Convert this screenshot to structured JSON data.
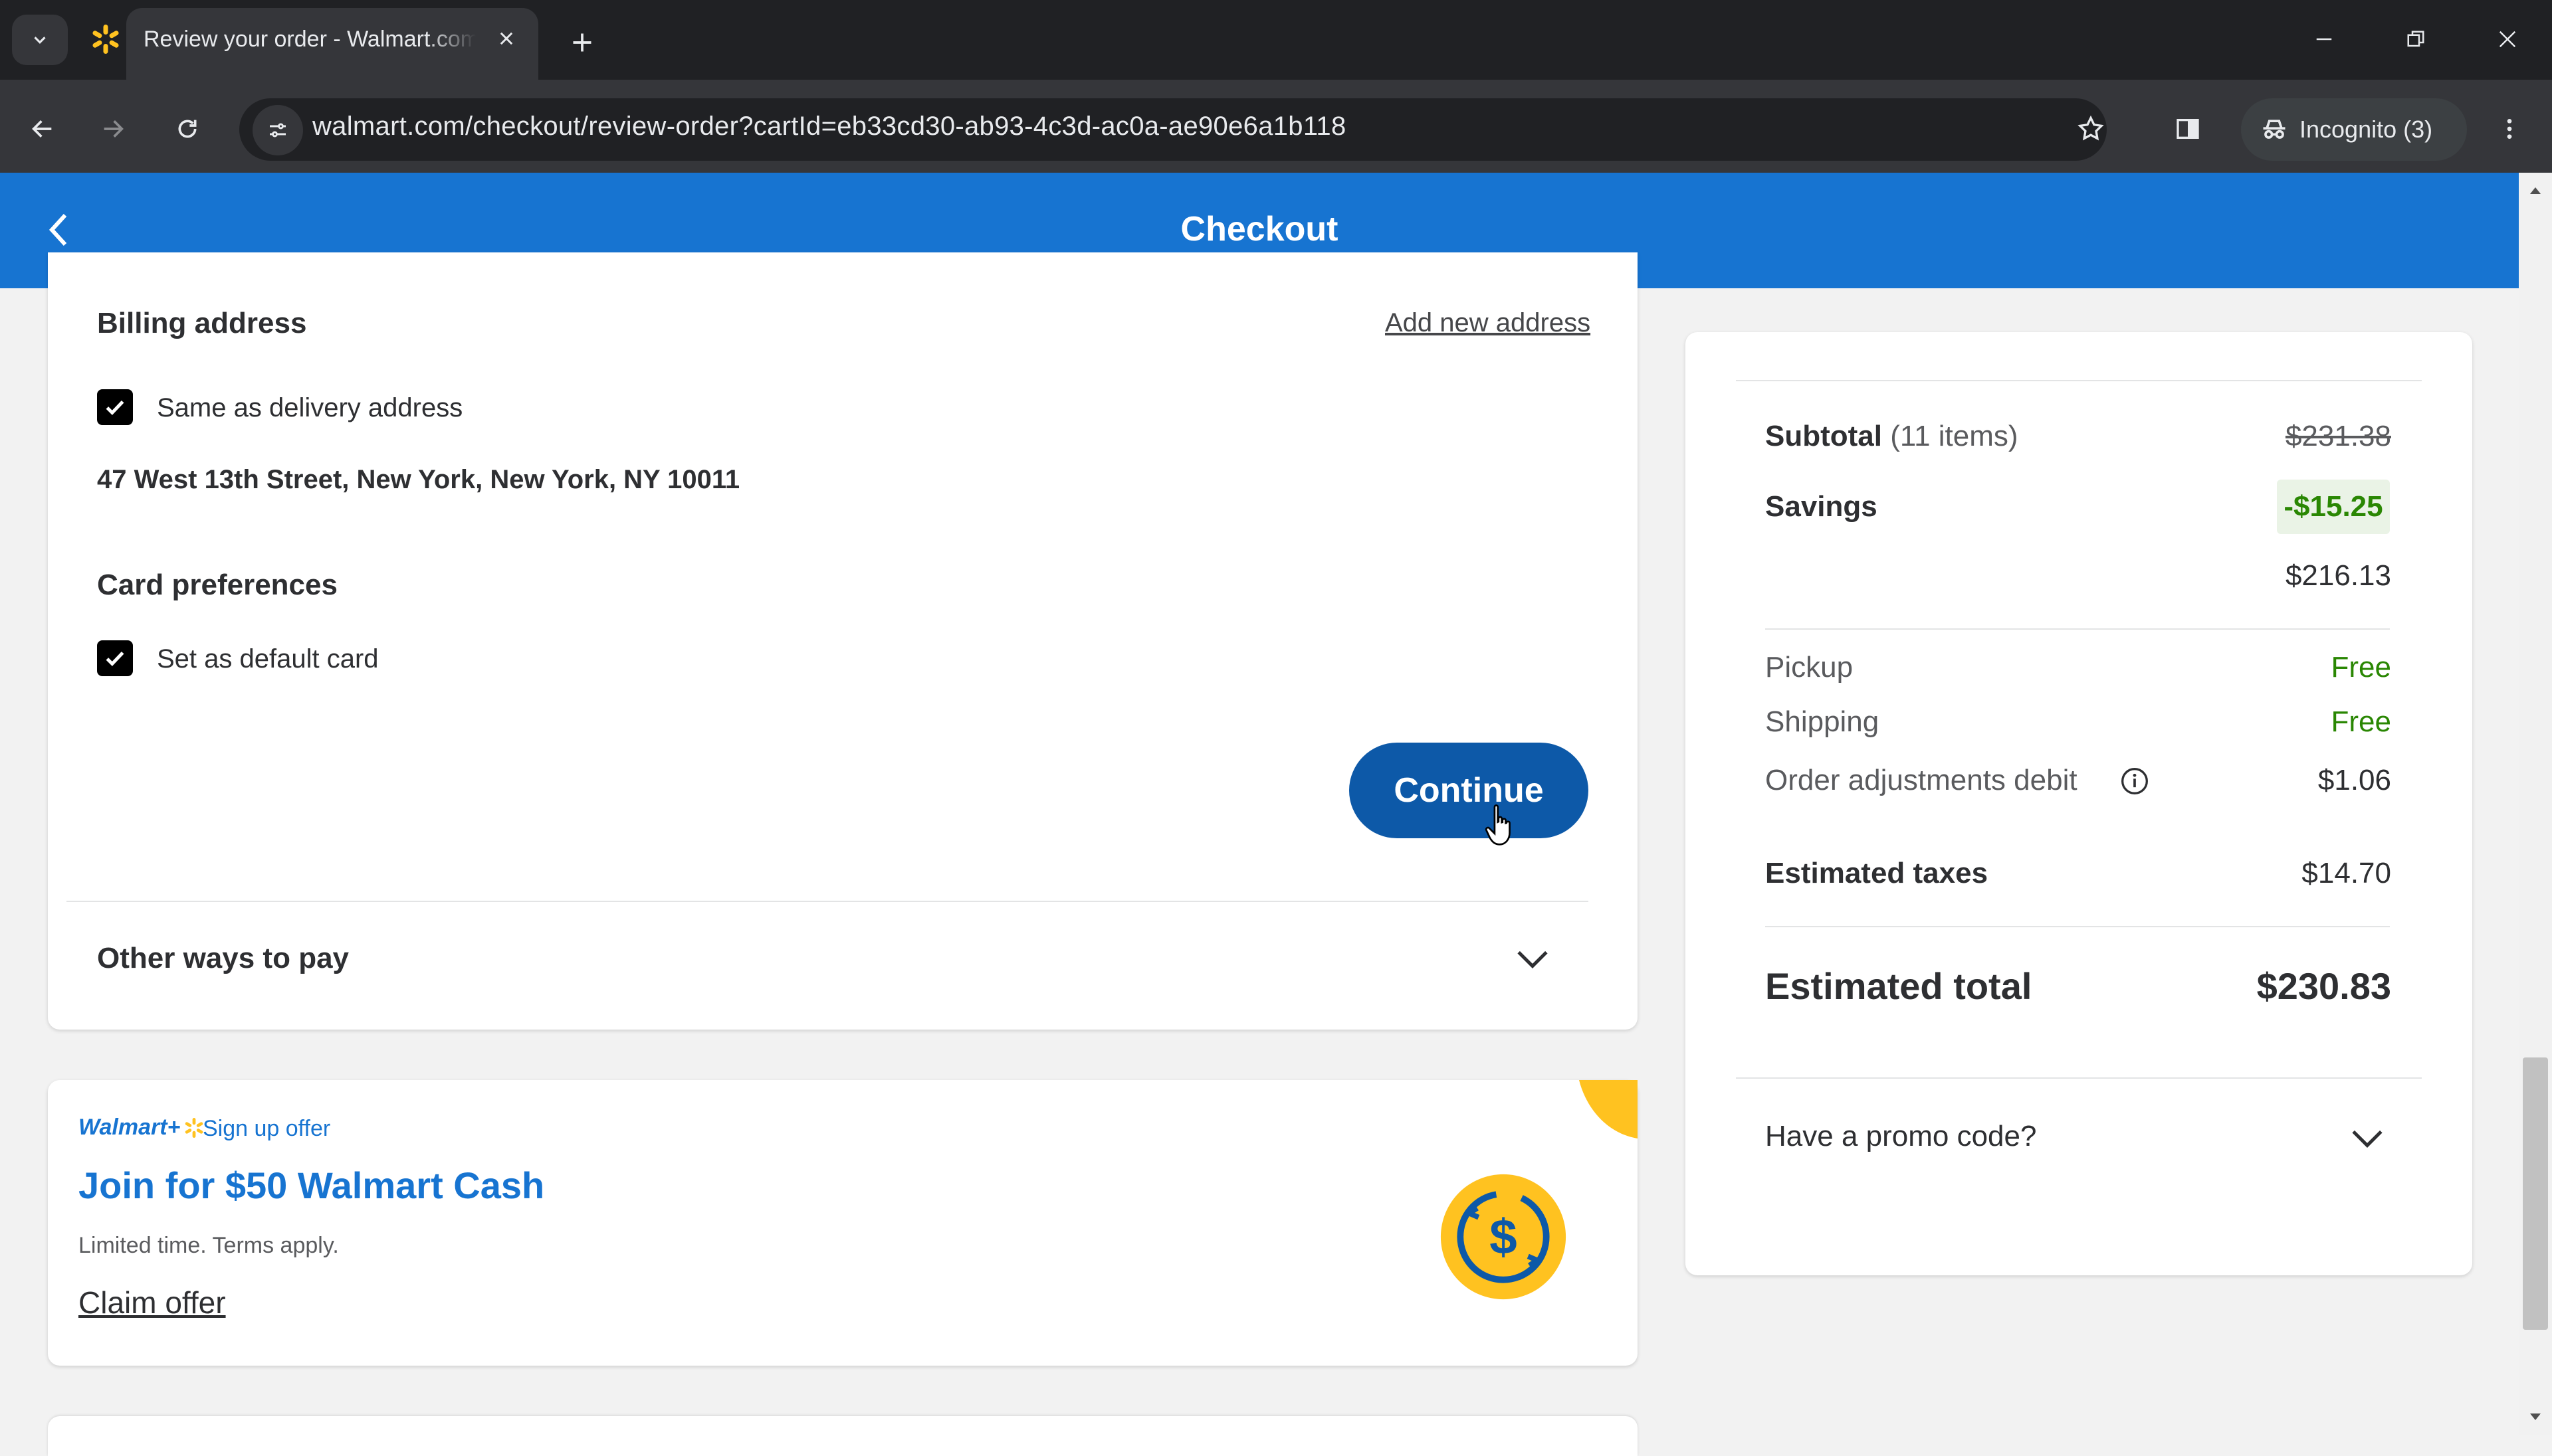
{
  "browser": {
    "tab_title": "Review your order - Walmart.com",
    "url": "walmart.com/checkout/review-order?cartId=eb33cd30-ab93-4c3d-ac0a-ae90e6a1b118",
    "incognito_label": "Incognito (3)"
  },
  "header": {
    "title": "Checkout"
  },
  "billing": {
    "title": "Billing address",
    "add_new_address": "Add new address",
    "same_as_delivery": "Same as delivery address",
    "address": "47 West 13th Street, New York, New York, NY 10011"
  },
  "card_preferences": {
    "title": "Card preferences",
    "set_default": "Set as default card"
  },
  "continue_label": "Continue",
  "other_ways_to_pay": "Other ways to pay",
  "walmart_plus": {
    "logo_text": "Walmart+",
    "offer_label": "Sign up offer",
    "title": "Join for $50 Walmart Cash",
    "subtitle": "Limited time. Terms apply.",
    "claim": "Claim offer"
  },
  "summary": {
    "subtotal_label": "Subtotal",
    "subtotal_items": "(11 items)",
    "subtotal_value": "$231.38",
    "savings_label": "Savings",
    "savings_value": "-$15.25",
    "after_savings": "$216.13",
    "pickup_label": "Pickup",
    "pickup_value": "Free",
    "shipping_label": "Shipping",
    "shipping_value": "Free",
    "adjustments_label": "Order adjustments debit",
    "adjustments_value": "$1.06",
    "taxes_label": "Estimated taxes",
    "taxes_value": "$14.70",
    "total_label": "Estimated total",
    "total_value": "$230.83",
    "promo_label": "Have a promo code?"
  },
  "colors": {
    "header_blue": "#1774d1",
    "button_blue": "#0d59a8",
    "savings_green": "#2a8703",
    "walmart_yellow": "#ffc220"
  }
}
